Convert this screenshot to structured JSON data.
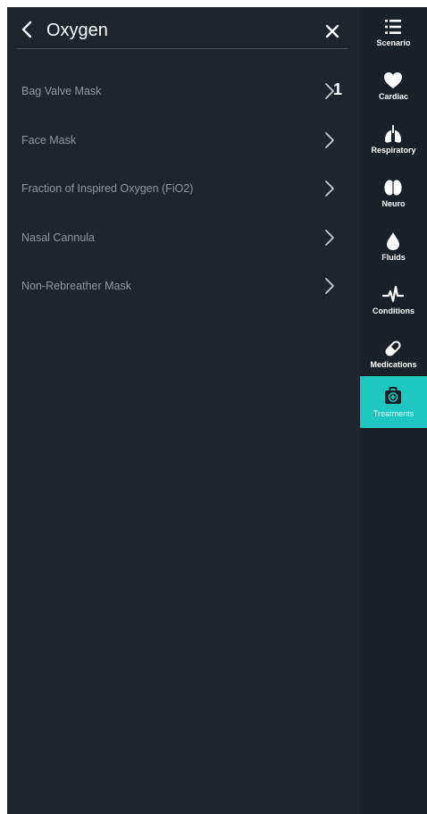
{
  "header": {
    "title": "Oxygen"
  },
  "list": {
    "items": [
      {
        "label": "Bag Valve Mask"
      },
      {
        "label": "Face Mask"
      },
      {
        "label": "Fraction of Inspired Oxygen (FiO2)"
      },
      {
        "label": "Nasal Cannula"
      },
      {
        "label": "Non-Rebreather Mask"
      }
    ]
  },
  "annotation": {
    "step": "1"
  },
  "rail": {
    "items": [
      {
        "label": "Scenario",
        "icon": "menu-list-icon"
      },
      {
        "label": "Cardiac",
        "icon": "heart-icon"
      },
      {
        "label": "Respiratory",
        "icon": "lungs-icon"
      },
      {
        "label": "Neuro",
        "icon": "brain-icon"
      },
      {
        "label": "Fluids",
        "icon": "droplet-icon"
      },
      {
        "label": "Conditions",
        "icon": "pulse-icon"
      },
      {
        "label": "Medications",
        "icon": "pill-icon"
      },
      {
        "label": "Treatments",
        "icon": "medkit-icon",
        "active": true
      }
    ]
  },
  "colors": {
    "panel_background": "#1e252d",
    "rail_background": "#1a2027",
    "accent": "#1ec8c1",
    "item_text": "#8d97a2",
    "title_text": "#ffffff"
  }
}
